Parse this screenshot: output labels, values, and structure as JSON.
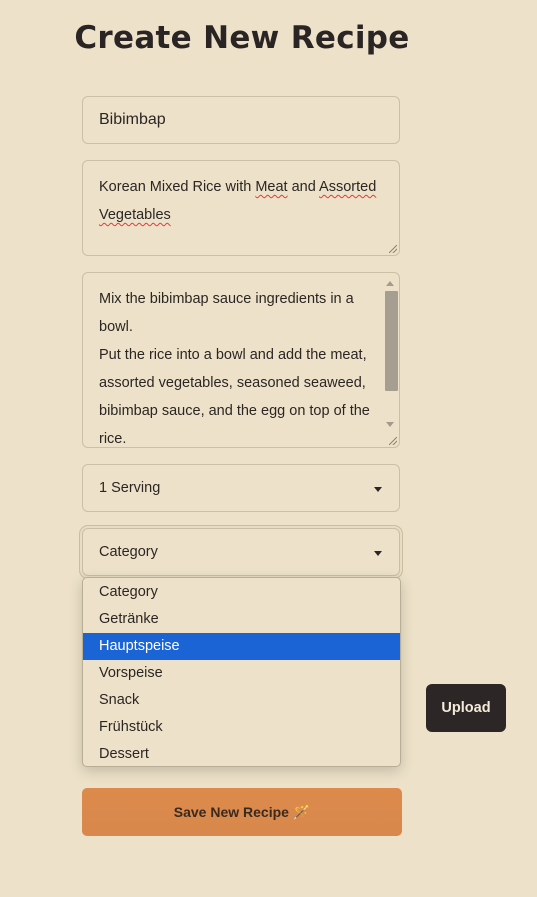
{
  "page": {
    "title": "Create New Recipe"
  },
  "form": {
    "name_value": "Bibimbap",
    "description_value": [
      "Korean Mixed Rice with ",
      "Meat",
      " and ",
      "Assorted",
      "Vegetables"
    ],
    "instructions_lines": [
      "Mix the bibimbap sauce ingredients in a",
      "bowl.",
      "Put the rice into a bowl and add the meat,",
      "assorted vegetables, seasoned seaweed,",
      "bibimbap sauce, and the egg on top of the",
      "rice."
    ],
    "servings_value": "1 Serving",
    "category_value": "Category",
    "category_options": [
      "Category",
      "Getränke",
      "Hauptspeise",
      "Vorspeise",
      "Snack",
      "Frühstück",
      "Dessert"
    ],
    "category_highlighted": "Hauptspeise",
    "upload_label": "Upload",
    "save_label": "Save New Recipe 🪄"
  },
  "colors": {
    "background": "#ede2c9",
    "highlight": "#1a64d6",
    "save_button": "#da894c",
    "upload_button": "#2c2627"
  }
}
